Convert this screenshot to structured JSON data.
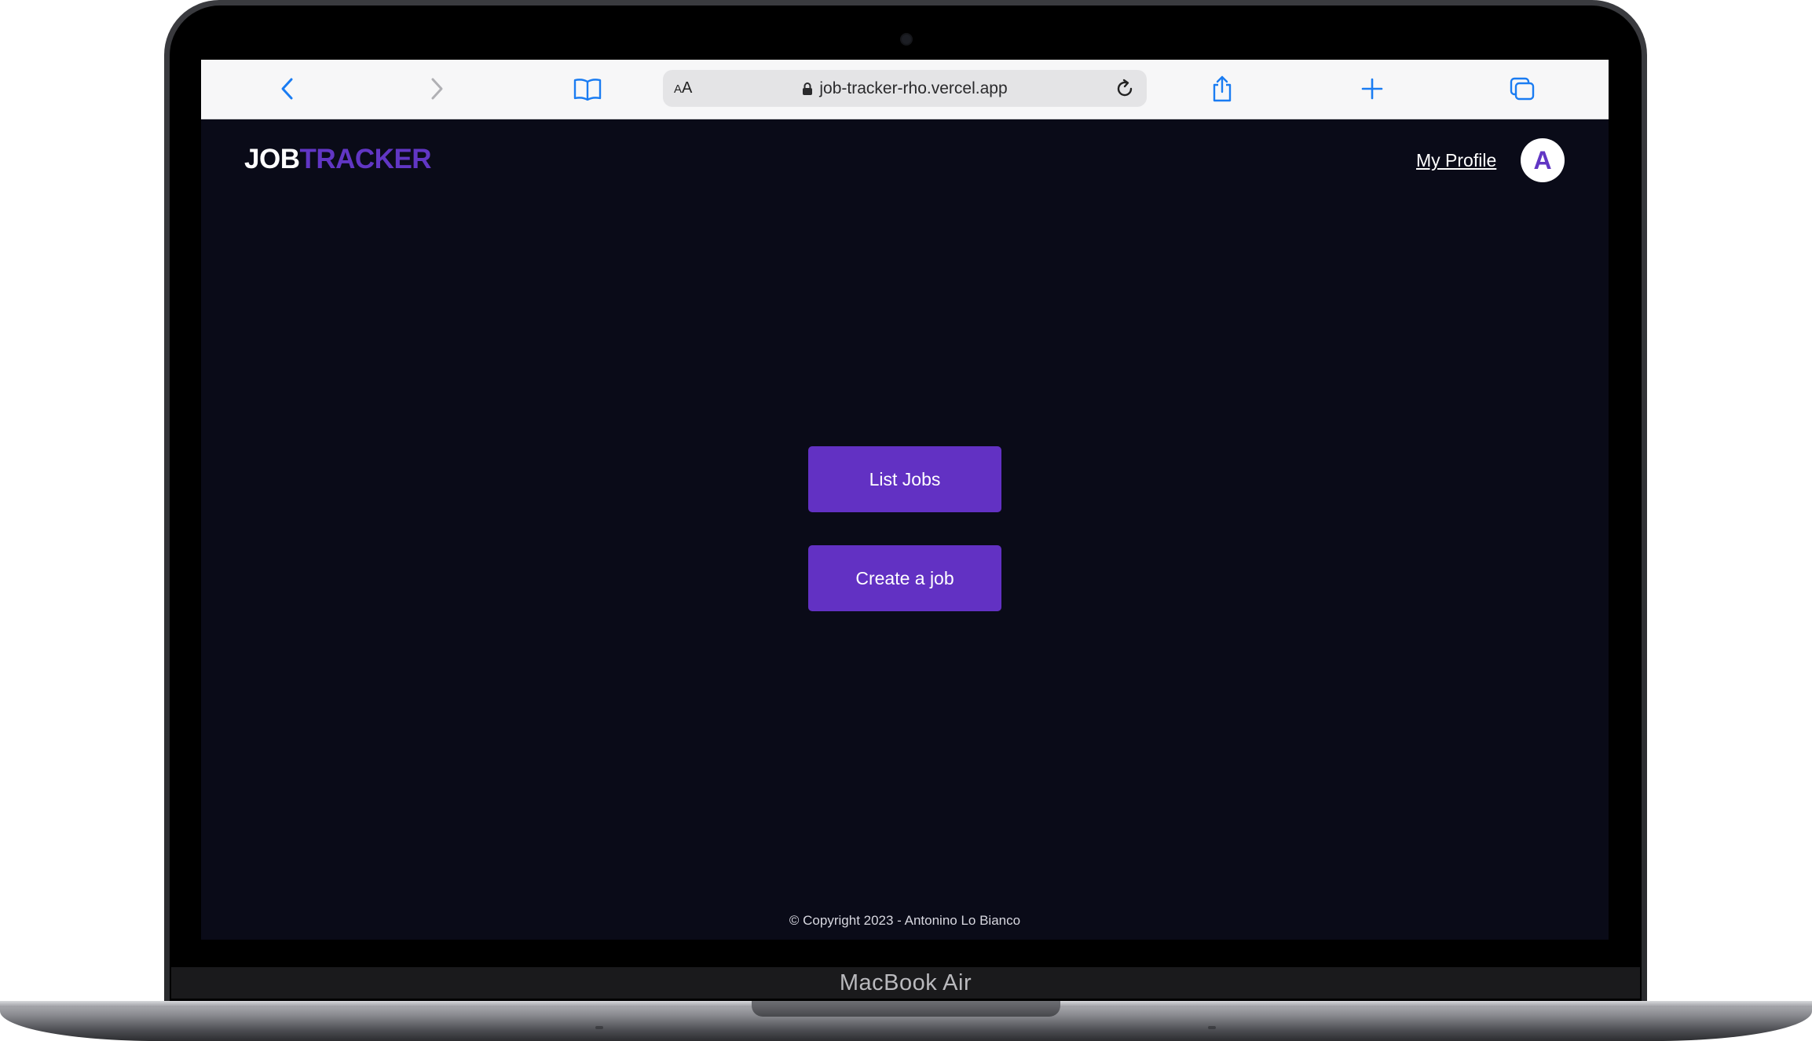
{
  "browser": {
    "url": "job-tracker-rho.vercel.app",
    "text_size_label_small": "A",
    "text_size_label_large": "A",
    "icon_color": "#1a7cf2"
  },
  "header": {
    "logo_part1": "JOB",
    "logo_part2": "TRACKER",
    "profile_link": "My Profile",
    "avatar_letter": "A"
  },
  "main": {
    "list_jobs_button": "List Jobs",
    "create_job_button": "Create a job"
  },
  "footer": {
    "copyright": "© Copyright 2023 - Antonino Lo Bianco"
  },
  "device": {
    "model_label": "MacBook Air"
  },
  "colors": {
    "background": "#0a0b18",
    "accent": "#6231c3",
    "logo_accent": "#6136c4"
  }
}
